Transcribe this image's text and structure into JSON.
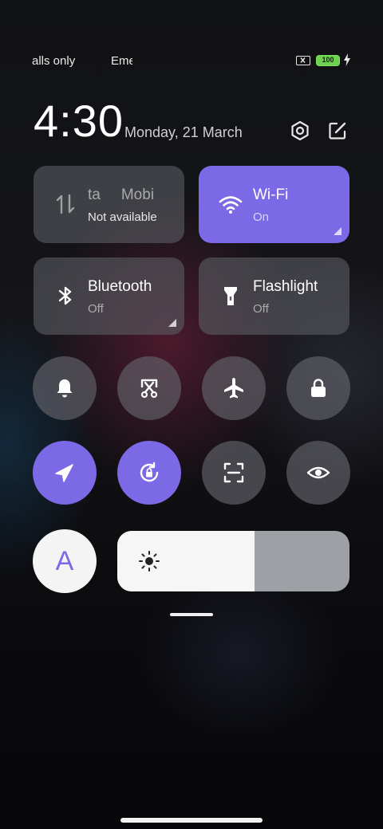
{
  "status_bar": {
    "carrier1": "alls only",
    "carrier2": "Eme",
    "battery_level": "100"
  },
  "header": {
    "time": "4:30",
    "date": "Monday, 21 March"
  },
  "tiles": {
    "mobile_data": {
      "title_part1": "ta",
      "title_part2": "Mobi",
      "status": "Not available"
    },
    "wifi": {
      "title": "Wi-Fi",
      "status": "On"
    },
    "bluetooth": {
      "title": "Bluetooth",
      "status": "Off"
    },
    "flashlight": {
      "title": "Flashlight",
      "status": "Off"
    }
  },
  "auto_brightness": {
    "label": "A"
  },
  "brightness": {
    "level": 0.59
  },
  "colors": {
    "accent": "#7b69e6",
    "tile_inactive": "#5a5c62",
    "battery": "#6fd14f"
  },
  "icons": [
    "sim-off-icon",
    "battery-icon",
    "charging-bolt-icon",
    "settings-icon",
    "edit-icon",
    "mobile-data-icon",
    "wifi-icon",
    "bluetooth-icon",
    "flashlight-icon",
    "bell-icon",
    "screenshot-icon",
    "airplane-icon",
    "lock-icon",
    "location-icon",
    "auto-rotate-icon",
    "scan-icon",
    "eye-icon",
    "sun-icon"
  ]
}
